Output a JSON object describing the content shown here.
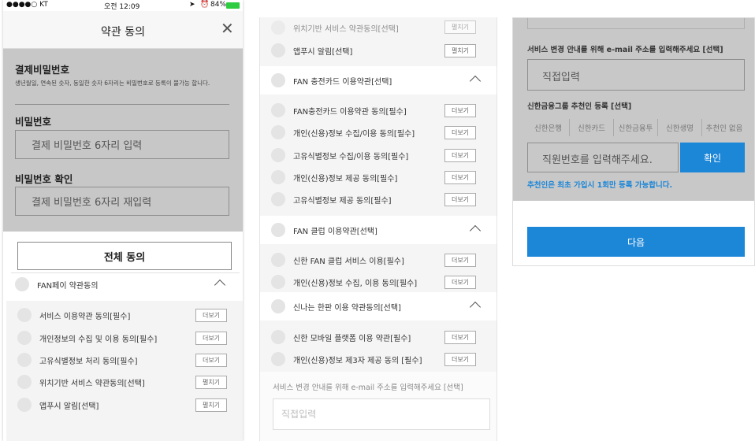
{
  "status_bar": {
    "carrier": "●●●●○ KT",
    "time": "오전 12:09",
    "battery": "84%"
  },
  "header": {
    "title": "약관 동의"
  },
  "payment_password": {
    "section_title": "결제비밀번호",
    "hint": "생년월일, 연속된 숫자, 동일한 숫자 6자리는 비밀번호로 등록이 불가능 합니다.",
    "password_label": "비밀번호",
    "password_placeholder": "결제 비밀번호 6자리 입력",
    "confirm_label": "비밀번호 확인",
    "confirm_placeholder": "결제 비밀번호 6자리 재입력"
  },
  "agree_all_label": "전체 동의",
  "more_label": "더보기",
  "expand_label": "펼치기",
  "fanpay": {
    "title": "FAN페이 약관동의",
    "items": [
      {
        "label": "서비스 이용약관 동의[필수]",
        "button": "더보기"
      },
      {
        "label": "개인정보의 수집 및 이용 동의[필수]",
        "button": "더보기"
      },
      {
        "label": "고유식별정보 처리 동의[필수]",
        "button": "더보기"
      },
      {
        "label": "위치기반 서비스 약관동의[선택]",
        "button": "펼치기"
      },
      {
        "label": "앱푸시 알림[선택]",
        "button": "펼치기"
      }
    ]
  },
  "panel2": {
    "top_items": [
      {
        "label": "위치기반 서비스 약관동의[선택]",
        "button": "펼치기"
      },
      {
        "label": "앱푸시 알림[선택]",
        "button": "펼치기"
      }
    ],
    "sections": [
      {
        "title": "FAN 충전카드 이용약관[선택]",
        "items": [
          "FAN충전카드 이용약관 동의[필수]",
          "개인(신용)정보 수집/이용 동의[필수]",
          "고유식별정보 수집/이용 동의[필수]",
          "개인(신용)정보 제공 동의[필수]",
          "고유식별정보 제공 동의[필수]"
        ]
      },
      {
        "title": "FAN 클럽 이용약관[선택]",
        "items": [
          "신한 FAN 클럽 서비스 이용[필수]",
          "개인(신용)정보 수집, 이용 동의[필수]"
        ]
      },
      {
        "title": "신나는 한판 이용 약관동의[선택]",
        "items": [
          "신한 모바일 플랫폼 이용 약관[필수]",
          "개인(신용)정보 제3자 제공 동의 [필수]"
        ]
      }
    ],
    "email_label": "서비스 변경 안내를 위해 e-mail 주소를 입력해주세요 [선택]",
    "email_placeholder": "직접입력"
  },
  "panel3": {
    "email_label": "서비스 변경 안내를 위해 e-mail 주소를 입력해주세요 [선택]",
    "email_placeholder": "직접입력",
    "recommender_label": "신한금융그룹 추천인 등록 [선택]",
    "companies": [
      "신한은행",
      "신한카드",
      "신한금융투",
      "신한생명",
      "추천인 없음"
    ],
    "employee_placeholder": "직원번호를 입력해주세요.",
    "confirm_button": "확인",
    "notice": "추천인은 최초 가입시 1회만 등록 가능합니다.",
    "next_button": "다음"
  },
  "colors": {
    "accent": "#1c86d7",
    "gray_panel": "#c7c7c7"
  }
}
